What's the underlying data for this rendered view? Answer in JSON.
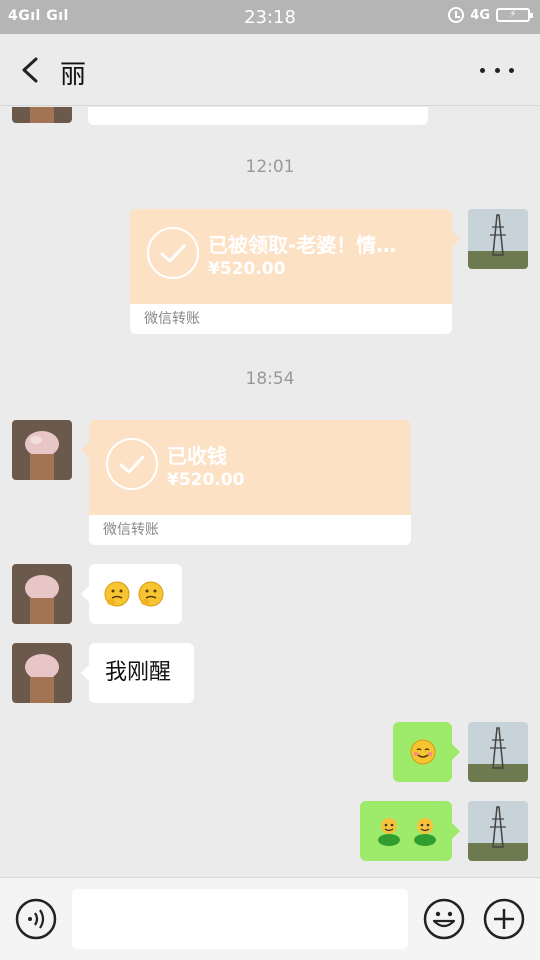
{
  "status_bar": {
    "left": "4Gıl Gıl",
    "time": "23:18",
    "network": "4G",
    "battery": "⚡"
  },
  "header": {
    "title": "丽"
  },
  "messages": {
    "timestamp_1": "12:01",
    "transfer_1": {
      "title": "已被领取-老婆！情…",
      "amount": "¥520.00",
      "footer": "微信转账"
    },
    "timestamp_2": "18:54",
    "transfer_2": {
      "title": "已收钱",
      "amount": "¥520.00",
      "footer": "微信转账"
    },
    "text_1": "我刚醒"
  },
  "input": {
    "placeholder": ""
  },
  "colors": {
    "transfer_bg": "#fde1c5",
    "sent_bubble": "#9eea6a",
    "background": "#ebebeb"
  },
  "icons": [
    "back-arrow-icon",
    "more-dots-icon",
    "voice-icon",
    "emoji-icon",
    "plus-icon",
    "check-icon",
    "thinking-face-emoji",
    "smile-emoji",
    "green-figure-emoji"
  ]
}
